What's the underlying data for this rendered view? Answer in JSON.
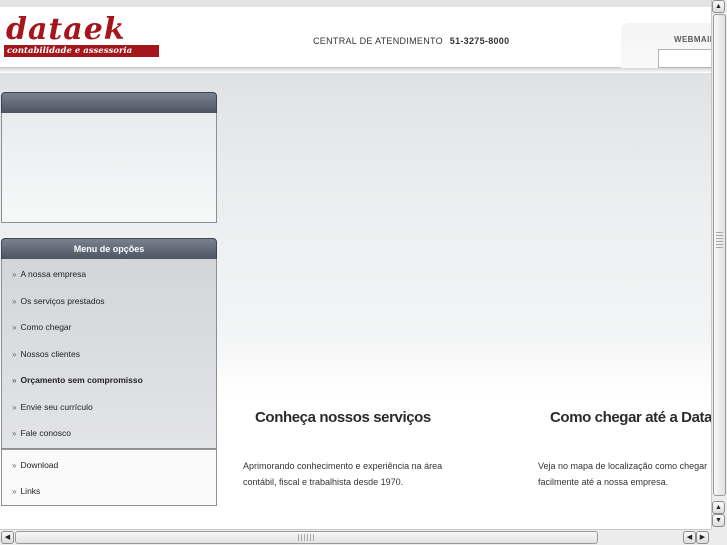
{
  "header": {
    "logo_word": "dataek",
    "logo_tagline": "contabilidade e assessoria",
    "central_label": "CENTRAL DE ATENDIMENTO",
    "central_phone": "51-3275-8000",
    "webmail_label": "WEBMAIL",
    "webmail_value": ""
  },
  "panel1": {
    "title": ""
  },
  "menu": {
    "title": "Menu de opções",
    "bullet": "»",
    "items": [
      "A nossa empresa",
      "Os serviços prestados",
      "Como chegar",
      "Nossos clientes",
      "Orçamento sem compromisso",
      "Envie seu currículo",
      "Fale conosco"
    ],
    "extra_items": [
      "Download",
      "Links"
    ]
  },
  "sections": [
    {
      "title": "Conheça nossos serviços",
      "line1": "Aprimorando conhecimento e experiência na área",
      "line2": "contábil, fiscal e trabalhista desde 1970."
    },
    {
      "title": "Como chegar até a Dataek",
      "line1": "Veja no mapa de localização como chegar",
      "line2": "facilmente até a nossa empresa."
    }
  ],
  "scrollbars": {
    "up_icon": "▲",
    "down_icon": "▼",
    "left_icon": "◀",
    "right_icon": "▶"
  }
}
